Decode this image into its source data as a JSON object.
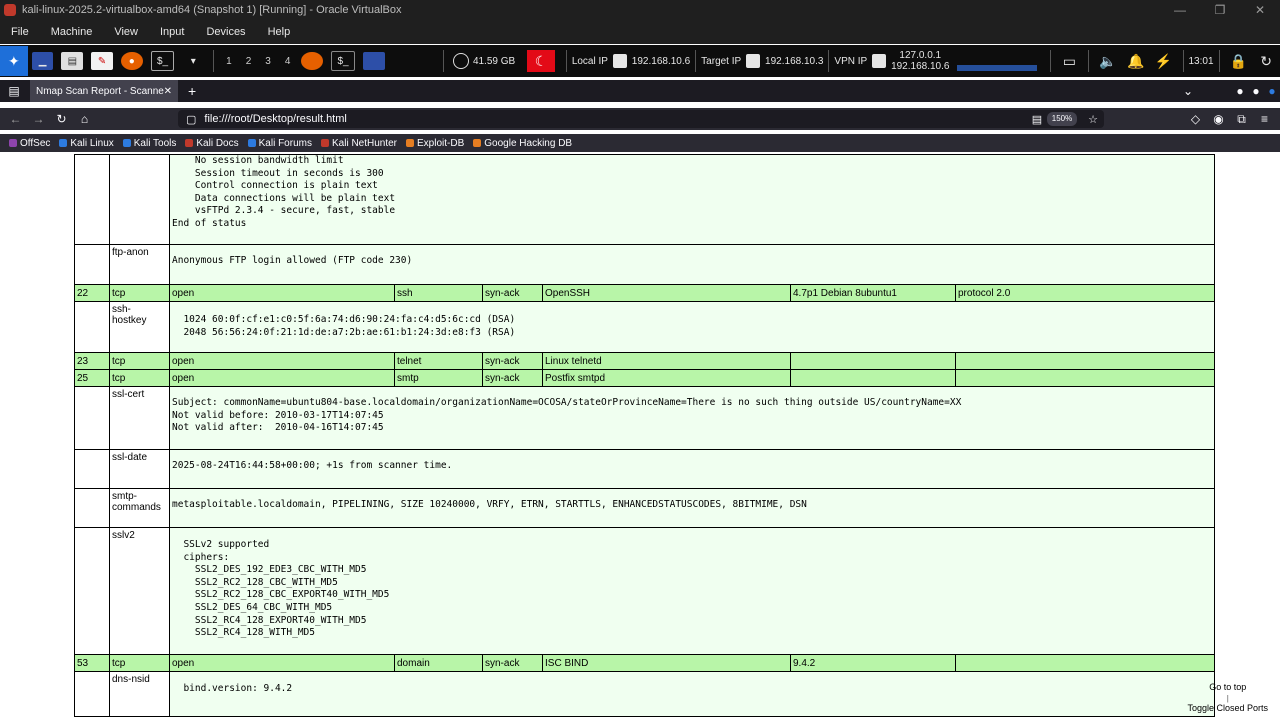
{
  "vbox": {
    "title": "kali-linux-2025.2-virtualbox-amd64 (Snapshot 1) [Running] - Oracle VirtualBox",
    "menu": [
      "File",
      "Machine",
      "View",
      "Input",
      "Devices",
      "Help"
    ]
  },
  "panel": {
    "workspaces": [
      "1",
      "2",
      "3",
      "4"
    ],
    "disk": "41.59 GB",
    "local_ip_label": "Local IP",
    "local_ip": "192.168.10.6",
    "target_ip_label": "Target IP",
    "target_ip": "192.168.10.3",
    "vpn_ip_label": "VPN IP",
    "vpn_ip_1": "127.0.0.1",
    "vpn_ip_2": "192.168.10.6",
    "time": "13:01"
  },
  "browser": {
    "tab_title": "Nmap Scan Report - Scanned",
    "url": "file:///root/Desktop/result.html",
    "zoom": "150%",
    "bookmarks": [
      "OffSec",
      "Kali Linux",
      "Kali Tools",
      "Kali Docs",
      "Kali Forums",
      "Kali NetHunter",
      "Exploit-DB",
      "Google Hacking DB"
    ]
  },
  "report": {
    "ftp_status_tail": "    No session bandwidth limit\n    Session timeout in seconds is 300\n    Control connection is plain text\n    Data connections will be plain text\n    vsFTPd 2.3.4 - secure, fast, stable\nEnd of status",
    "ftp_anon": {
      "name": "ftp-anon",
      "output": "Anonymous FTP login allowed (FTP code 230)"
    },
    "p22": {
      "port": "22",
      "proto": "tcp",
      "state": "open",
      "service": "ssh",
      "reason": "syn-ack",
      "product": "OpenSSH",
      "version": "4.7p1 Debian 8ubuntu1",
      "extra": "protocol 2.0"
    },
    "ssh_hostkey": {
      "name": "ssh-\nhostkey",
      "output": "  1024 60:0f:cf:e1:c0:5f:6a:74:d6:90:24:fa:c4:d5:6c:cd (DSA)\n  2048 56:56:24:0f:21:1d:de:a7:2b:ae:61:b1:24:3d:e8:f3 (RSA)"
    },
    "p23": {
      "port": "23",
      "proto": "tcp",
      "state": "open",
      "service": "telnet",
      "reason": "syn-ack",
      "product": "Linux telnetd",
      "version": "",
      "extra": ""
    },
    "p25": {
      "port": "25",
      "proto": "tcp",
      "state": "open",
      "service": "smtp",
      "reason": "syn-ack",
      "product": "Postfix smtpd",
      "version": "",
      "extra": ""
    },
    "ssl_cert": {
      "name": "ssl-cert",
      "output": "Subject: commonName=ubuntu804-base.localdomain/organizationName=OCOSA/stateOrProvinceName=There is no such thing outside US/countryName=XX\nNot valid before: 2010-03-17T14:07:45\nNot valid after:  2010-04-16T14:07:45"
    },
    "ssl_date": {
      "name": "ssl-date",
      "output": "2025-08-24T16:44:58+00:00; +1s from scanner time."
    },
    "smtp_commands": {
      "name": "smtp-\ncommands",
      "output": "metasploitable.localdomain, PIPELINING, SIZE 10240000, VRFY, ETRN, STARTTLS, ENHANCEDSTATUSCODES, 8BITMIME, DSN"
    },
    "sslv2": {
      "name": "sslv2",
      "output": "  SSLv2 supported\n  ciphers:\n    SSL2_DES_192_EDE3_CBC_WITH_MD5\n    SSL2_RC2_128_CBC_WITH_MD5\n    SSL2_RC2_128_CBC_EXPORT40_WITH_MD5\n    SSL2_DES_64_CBC_WITH_MD5\n    SSL2_RC4_128_EXPORT40_WITH_MD5\n    SSL2_RC4_128_WITH_MD5"
    },
    "p53": {
      "port": "53",
      "proto": "tcp",
      "state": "open",
      "service": "domain",
      "reason": "syn-ack",
      "product": "ISC BIND",
      "version": "9.4.2",
      "extra": ""
    },
    "dns_nsid": {
      "name": "dns-nsid",
      "output": "  bind.version: 9.4.2"
    }
  },
  "links": {
    "top": "Go to top",
    "toggle": "Toggle Closed Ports"
  }
}
